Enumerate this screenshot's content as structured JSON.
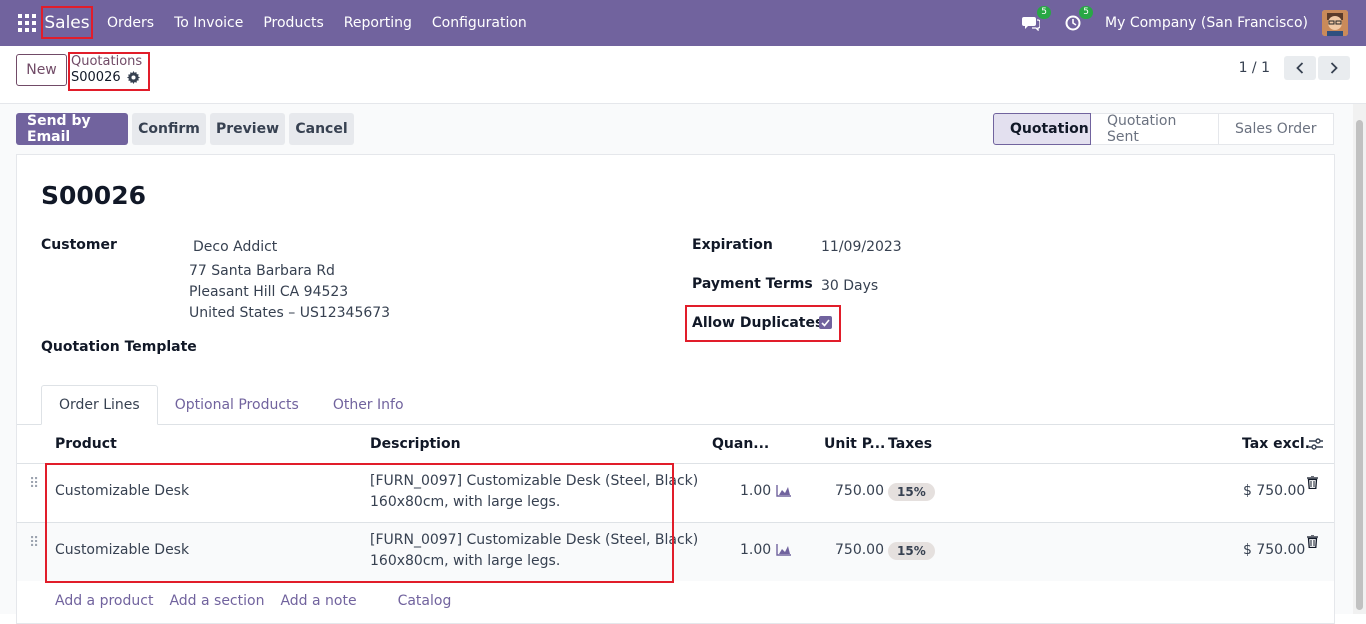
{
  "topbar": {
    "app_name": "Sales",
    "menu": [
      "Orders",
      "To Invoice",
      "Products",
      "Reporting",
      "Configuration"
    ],
    "messages_count": "5",
    "activities_count": "5",
    "company": "My Company (San Francisco)"
  },
  "control": {
    "new_label": "New",
    "breadcrumb_parent": "Quotations",
    "breadcrumb_current": "S00026",
    "pager": "1 / 1"
  },
  "actions": {
    "send_email": "Send by Email",
    "confirm": "Confirm",
    "preview": "Preview",
    "cancel": "Cancel"
  },
  "statusbar": [
    "Quotation",
    "Quotation Sent",
    "Sales Order"
  ],
  "form": {
    "title": "S00026",
    "customer_label": "Customer",
    "customer_name": "Deco Addict",
    "address_line1": "77 Santa Barbara Rd",
    "address_line2": "Pleasant Hill CA 94523",
    "address_line3": "United States – US12345673",
    "template_label": "Quotation Template",
    "expiration_label": "Expiration",
    "expiration_value": "11/09/2023",
    "payment_terms_label": "Payment Terms",
    "payment_terms_value": "30 Days",
    "allow_duplicates_label": "Allow Duplicates",
    "allow_duplicates_checked": true
  },
  "tabs": [
    "Order Lines",
    "Optional Products",
    "Other Info"
  ],
  "table": {
    "headers": {
      "product": "Product",
      "description": "Description",
      "quantity": "Quan...",
      "unit_price": "Unit P...",
      "taxes": "Taxes",
      "subtotal": "Tax excl."
    },
    "rows": [
      {
        "product": "Customizable Desk",
        "desc1": "[FURN_0097] Customizable Desk (Steel, Black)",
        "desc2": "160x80cm, with large legs.",
        "quantity": "1.00",
        "unit_price": "750.00",
        "tax": "15%",
        "subtotal": "$ 750.00"
      },
      {
        "product": "Customizable Desk",
        "desc1": "[FURN_0097] Customizable Desk (Steel, Black)",
        "desc2": "160x80cm, with large legs.",
        "quantity": "1.00",
        "unit_price": "750.00",
        "tax": "15%",
        "subtotal": "$ 750.00"
      }
    ],
    "footer_links": [
      "Add a product",
      "Add a section",
      "Add a note",
      "Catalog"
    ]
  },
  "colors": {
    "brand": "#71639e",
    "highlight": "#e11d2a",
    "badge": "#28a745"
  }
}
